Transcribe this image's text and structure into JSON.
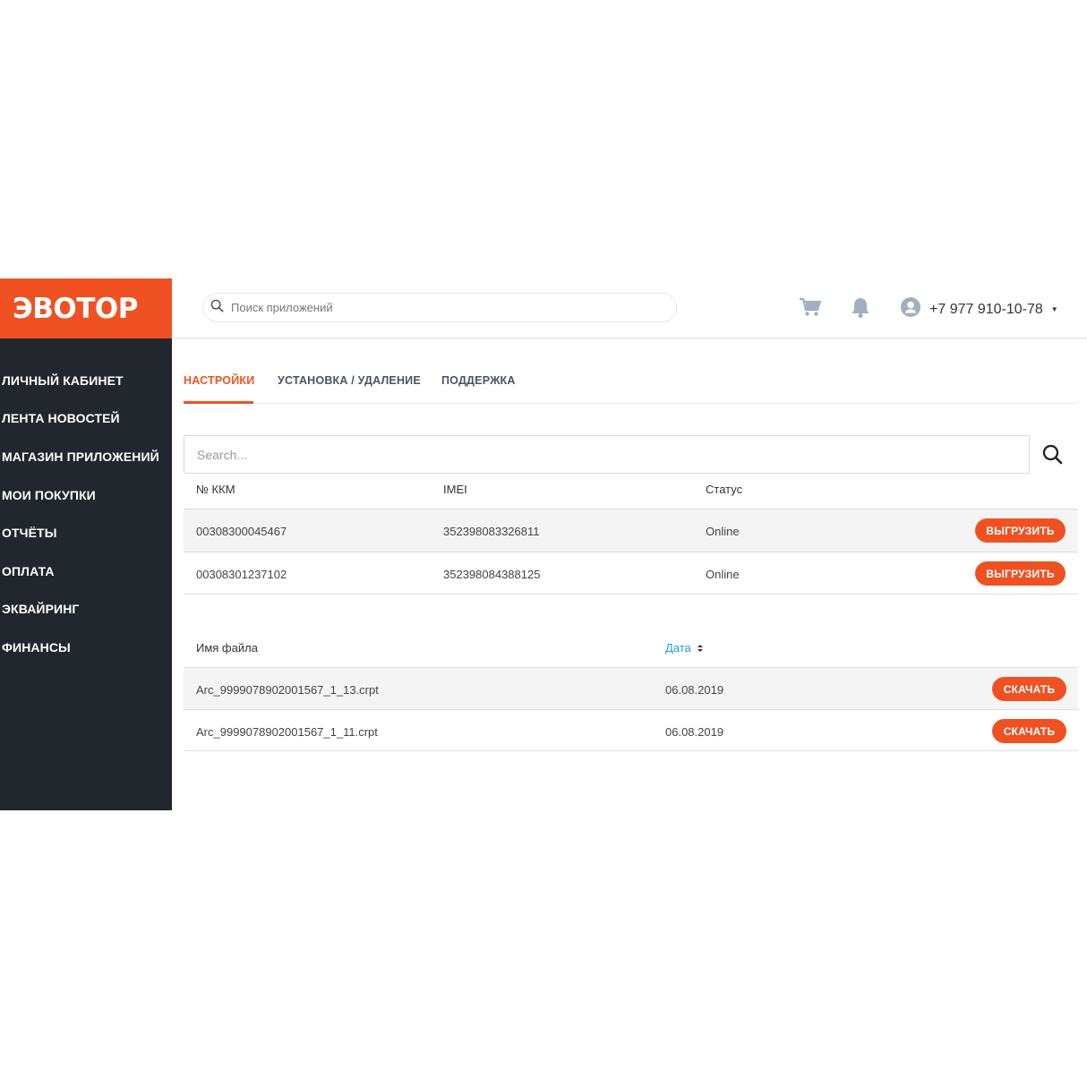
{
  "logo": {
    "text": "ЭВОТОР"
  },
  "colors": {
    "brand": "#f05122",
    "sidebar": "#22272d",
    "link": "#2a9ad8"
  },
  "sidebar": {
    "items": [
      {
        "label": "ЛИЧНЫЙ КАБИНЕТ"
      },
      {
        "label": "ЛЕНТА НОВОСТЕЙ"
      },
      {
        "label": "МАГАЗИН ПРИЛОЖЕНИЙ"
      },
      {
        "label": "МОИ ПОКУПКИ"
      },
      {
        "label": "ОТЧЁТЫ"
      },
      {
        "label": "ОПЛАТА"
      },
      {
        "label": "ЭКВАЙРИНГ"
      },
      {
        "label": "ФИНАНСЫ"
      }
    ]
  },
  "header": {
    "search_placeholder": "Поиск приложений",
    "icons": [
      "search-icon",
      "cart-icon",
      "bell-icon",
      "user-avatar-icon",
      "caret-down-icon"
    ],
    "phone": "+7 977 910-10-78",
    "caret": "▼"
  },
  "tabs": [
    {
      "label": "НАСТРОЙКИ",
      "active": true
    },
    {
      "label": "УСТАНОВКА / УДАЛЕНИЕ",
      "active": false
    },
    {
      "label": "ПОДДЕРЖКА",
      "active": false
    }
  ],
  "device_table": {
    "search_placeholder": "Search...",
    "headers": {
      "kkm": "№ ККМ",
      "imei": "IMEI",
      "status": "Статус"
    },
    "rows": [
      {
        "kkm": "00308300045467",
        "imei": "352398083326811",
        "status": "Online",
        "action": "ВЫГРУЗИТЬ"
      },
      {
        "kkm": "00308301237102",
        "imei": "352398084388125",
        "status": "Online",
        "action": "ВЫГРУЗИТЬ"
      }
    ]
  },
  "files_table": {
    "headers": {
      "name": "Имя файла",
      "date": "Дата"
    },
    "sort_icon": "sort-icon",
    "rows": [
      {
        "name": "Arc_9999078902001567_1_13.crpt",
        "date": "06.08.2019",
        "action": "СКАЧАТЬ"
      },
      {
        "name": "Arc_9999078902001567_1_11.crpt",
        "date": "06.08.2019",
        "action": "СКАЧАТЬ"
      }
    ]
  }
}
